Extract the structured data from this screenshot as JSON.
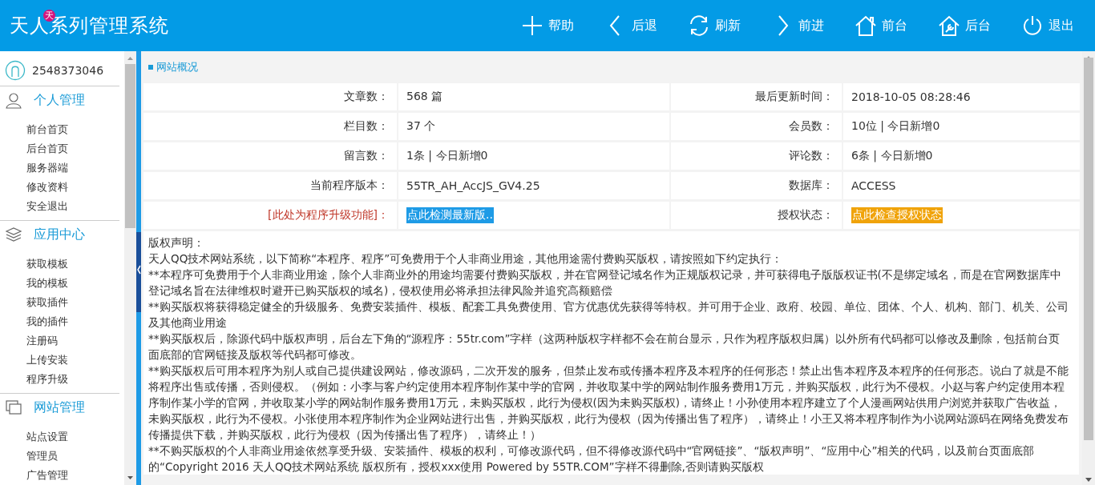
{
  "header": {
    "logo_main": "天人",
    "logo_badge": "天",
    "logo_rest": "系列管理系统",
    "nav": [
      {
        "label": "帮助",
        "kind": "plus"
      },
      {
        "label": "后退",
        "kind": "back"
      },
      {
        "label": "刷新",
        "kind": "refresh"
      },
      {
        "label": "前进",
        "kind": "forward"
      },
      {
        "label": "前台",
        "kind": "home"
      },
      {
        "label": "后台",
        "kind": "home-tool"
      },
      {
        "label": "退出",
        "kind": "power"
      }
    ]
  },
  "sidebar": {
    "user": "2548373046",
    "sections": [
      {
        "title": "个人管理",
        "kind": "person",
        "items": [
          "前台首页",
          "后台首页",
          "服务器端",
          "修改资料",
          "安全退出"
        ]
      },
      {
        "title": "应用中心",
        "kind": "layers",
        "items": [
          "获取模板",
          "我的模板",
          "获取插件",
          "我的插件",
          "注册码",
          "上传安装",
          "程序升级"
        ]
      },
      {
        "title": "网站管理",
        "kind": "windows",
        "items": [
          "站点设置",
          "管理员",
          "广告管理"
        ]
      }
    ]
  },
  "panel": {
    "title": "网站概况",
    "rows": [
      [
        {
          "label": "文章数：",
          "value": "568 篇"
        },
        {
          "label": "最后更新时间：",
          "value": "2018-10-05 08:28:46"
        }
      ],
      [
        {
          "label": "栏目数：",
          "value": "37 个"
        },
        {
          "label": "会员数：",
          "value": "10位 | 今日新增0"
        }
      ],
      [
        {
          "label": "留言数：",
          "value": "1条 | 今日新增0"
        },
        {
          "label": "评论数：",
          "value": "6条 | 今日新增0"
        }
      ],
      [
        {
          "label": "当前程序版本：",
          "value": "55TR_AH_AccJS_GV4.25"
        },
        {
          "label": "数据库：",
          "value": "ACCESS"
        }
      ],
      [
        {
          "label": "[此处为程序升级功能]：",
          "kind": "upgrade",
          "value": "点此检测最新版..",
          "color": "#1e9be6"
        },
        {
          "label": "授权状态：",
          "kind": "link",
          "value": "点此检查授权状态",
          "color": "#f0a30a"
        }
      ]
    ],
    "notice_title": "版权声明：",
    "paragraphs": [
      "天人QQ技术网站系统，以下简称“本程序、程序”可免费用于个人非商业用途，其他用途需付费购买版权，请按照如下约定执行：",
      "**本程序可免费用于个人非商业用途，除个人非商业外的用途均需要付费购买版权，并在官网登记域名作为正规版权记录，并可获得电子版版权证书(不是绑定域名，而是在官网数据库中登记域名旨在法律维权时避开已购买版权的域名)，侵权使用必将承担法律风险并追究高额赔偿",
      "**购买版权将获得稳定健全的升级服务、免费安装插件、模板、配套工具免费使用、官方优惠优先获得等特权。并可用于企业、政府、校园、单位、团体、个人、机构、部门、机关、公司及其他商业用途",
      "**购买版权后，除源代码中版权声明，后台左下角的“源程序：55tr.com”字样（这两种版权字样都不会在前台显示，只作为程序版权归属）以外所有代码都可以修改及删除，包括前台页面底部的官网链接及版权等代码都可修改。",
      "**购买版权后可用本程序为别人或自己提供建设网站，修改源码，二次开发的服务，但禁止发布或传播本程序及本程序的任何形态！禁止出售本程序及本程序的任何形态。说白了就是不能将程序出售或传播，否则侵权。（例如：小李与客户约定使用本程序制作某中学的官网，并收取某中学的网站制作服务费用1万元，并购买版权，此行为不侵权。小赵与客户约定使用本程序制作某小学的官网，并收取某小学的网站制作服务费用1万元，未购买版权，此行为侵权(因为未购买版权)，请终止！小孙使用本程序建立了个人漫画网站供用户浏览并获取广告收益，未购买版权，此行为不侵权。小张使用本程序制作为企业网站进行出售，并购买版权，此行为侵权（因为传播出售了程序），请终止！小王又将本程序制作为小说网站源码在网络免费发布传播提供下载，并购买版权，此行为侵权（因为传播出售了程序），请终止！）",
      "**不购买版权的个人非商业用途依然享受升级、安装插件、模板的权利，可修改源代码，但不得修改源代码中“官网链接”、“版权声明”、“应用中心”相关的代码，以及前台页面底部的“Copyright 2016 天人QQ技术网站系统 版权所有，授权xxx使用 Powered by 55TR.COM”字样不得删除,否则请购买版权"
    ]
  }
}
